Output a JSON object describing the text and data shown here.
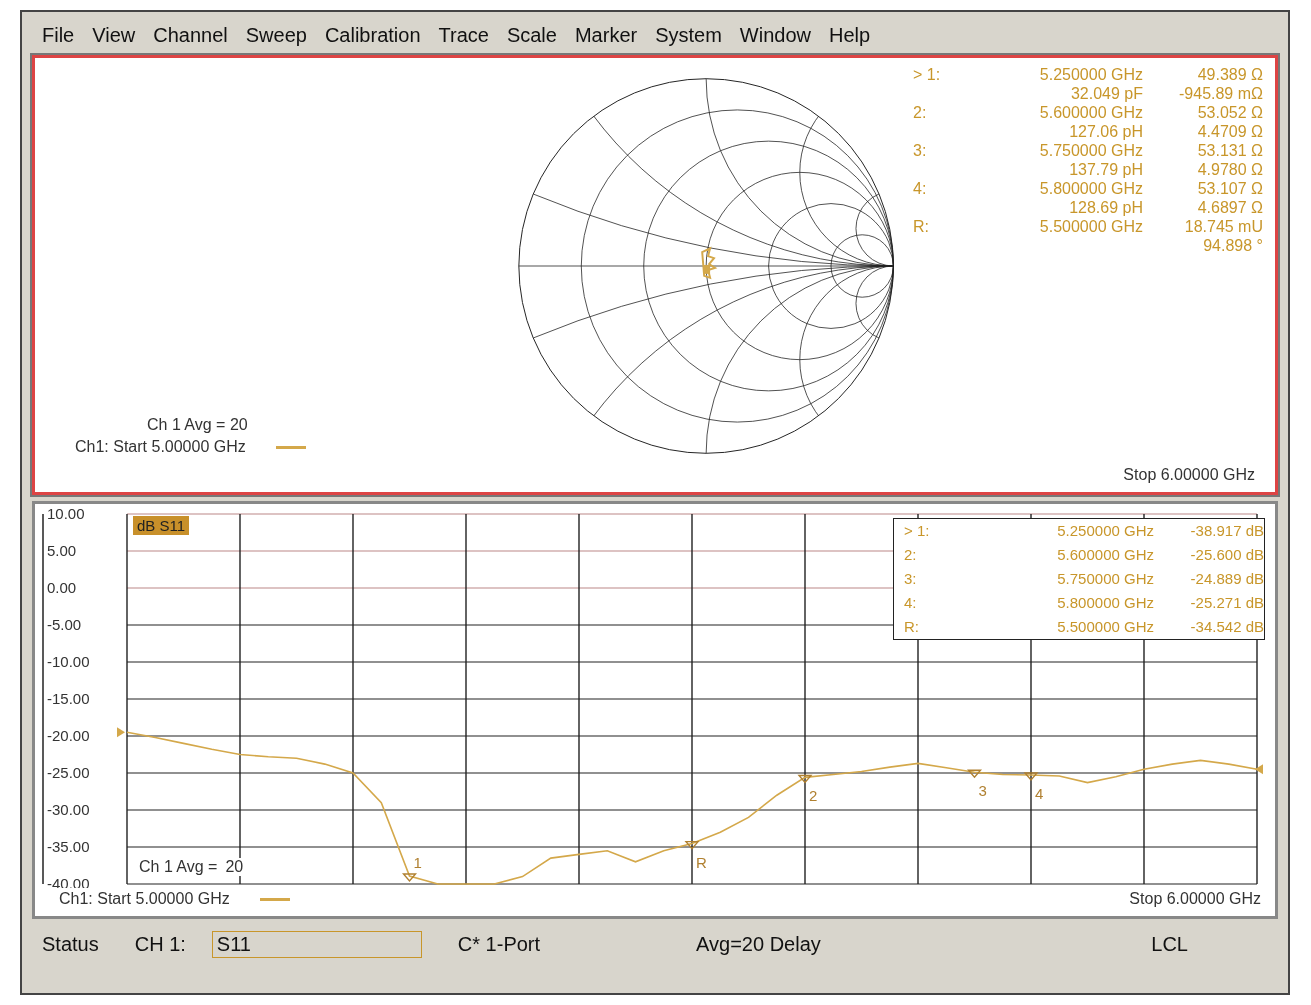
{
  "menu": [
    {
      "label": "File"
    },
    {
      "label": "View"
    },
    {
      "label": "Channel"
    },
    {
      "label": "Sweep"
    },
    {
      "label": "Calibration"
    },
    {
      "label": "Trace"
    },
    {
      "label": "Scale"
    },
    {
      "label": "Marker"
    },
    {
      "label": "System"
    },
    {
      "label": "Window"
    },
    {
      "label": "Help"
    }
  ],
  "smith_window": {
    "selected": true,
    "avg": "Ch 1 Avg =  20",
    "start": "Ch1: Start 5.00000 GHz",
    "stop": "Stop 6.00000 GHz",
    "markers": [
      {
        "label": "> 1:",
        "frequency": "5.250000 GHz",
        "value": "49.389 Ω",
        "second_left": "32.049 pF",
        "second_right": "-945.89 mΩ"
      },
      {
        "label": "2:",
        "frequency": "5.600000 GHz",
        "value": "53.052 Ω",
        "second_left": "127.06 pH",
        "second_right": "4.4709 Ω"
      },
      {
        "label": "3:",
        "frequency": "5.750000 GHz",
        "value": "53.131 Ω",
        "second_left": "137.79 pH",
        "second_right": "4.9780 Ω"
      },
      {
        "label": "4:",
        "frequency": "5.800000 GHz",
        "value": "53.107 Ω",
        "second_left": "128.69 pH",
        "second_right": "4.6897 Ω"
      },
      {
        "label": "R:",
        "frequency": "5.500000 GHz",
        "value": "18.745 mU",
        "second_right": "94.898 °"
      }
    ]
  },
  "log_window": {
    "selected": false,
    "avg_label": "Ch 1 Avg =",
    "avg_value": "20",
    "start": "Ch1: Start 5.00000 GHz",
    "stop": "Stop 6.00000 GHz",
    "markers": [
      {
        "label": "> 1:",
        "frequency": "5.250000 GHz",
        "value": "-38.917 dB"
      },
      {
        "label": "2:",
        "frequency": "5.600000 GHz",
        "value": "-25.600 dB"
      },
      {
        "label": "3:",
        "frequency": "5.750000 GHz",
        "value": "-24.889 dB"
      },
      {
        "label": "4:",
        "frequency": "5.800000 GHz",
        "value": "-25.271 dB"
      },
      {
        "label": "R:",
        "frequency": "5.500000 GHz",
        "value": "-34.542 dB"
      }
    ],
    "chart_data": {
      "type": "line",
      "categories": [
        null,
        null,
        null,
        null,
        null,
        null,
        null,
        null,
        null,
        null,
        null,
        null,
        null,
        null,
        null,
        null,
        null,
        null,
        null,
        null,
        null,
        null,
        null,
        null,
        null,
        null,
        null,
        null,
        null,
        null,
        null,
        null,
        null,
        null,
        null,
        null,
        null,
        null,
        null,
        null,
        null
      ],
      "series": [
        {
          "name": "dB S11",
          "color": "#d4a84a",
          "values": [
            -19.5,
            -20.2,
            -21,
            -21.8,
            -22.5,
            -22.8,
            -23,
            -23.8,
            -25,
            -29,
            -38.917,
            -40,
            -40,
            -40,
            -39,
            -36.5,
            -36,
            -35.5,
            -37,
            -35.5,
            -34.542,
            -33,
            -31,
            -28,
            -25.6,
            -25.2,
            -24.8,
            -24.2,
            -23.7,
            -24.3,
            -24.889,
            -25.2,
            -25.271,
            -25.4,
            -26.3,
            -25.5,
            -24.5,
            -23.8,
            -23.3,
            -23.8,
            -24.5
          ]
        }
      ],
      "ylim": [
        -40,
        10
      ],
      "grid": true,
      "yticks": [
        {
          "value": 10,
          "label": "10.00"
        },
        {
          "value": 5,
          "label": "5.00"
        },
        {
          "value": 0,
          "label": "0.00"
        },
        {
          "value": -5,
          "label": "-5.00"
        },
        {
          "value": -10,
          "label": "-10.00"
        },
        {
          "value": -15,
          "label": "-15.00"
        },
        {
          "value": -20,
          "label": "-20.00"
        },
        {
          "value": -25,
          "label": "-25.00"
        },
        {
          "value": -30,
          "label": "-30.00"
        },
        {
          "value": -35,
          "label": "-35.00"
        },
        {
          "value": -40,
          "label": "-40.00"
        }
      ],
      "annotations": [
        {
          "y": -38.917,
          "text": "1"
        },
        {
          "y": -25.6,
          "text": "2"
        },
        {
          "y": -24.889,
          "text": "3"
        },
        {
          "y": -25.271,
          "text": "4"
        },
        {
          "y": -34.542,
          "text": "R"
        }
      ]
    }
  },
  "status_bar": {
    "label": "Status",
    "channel": "CH 1:",
    "parameter": "S11",
    "calibration": "C* 1-Port",
    "info": "Avg=20 Delay",
    "mode": "LCL"
  }
}
